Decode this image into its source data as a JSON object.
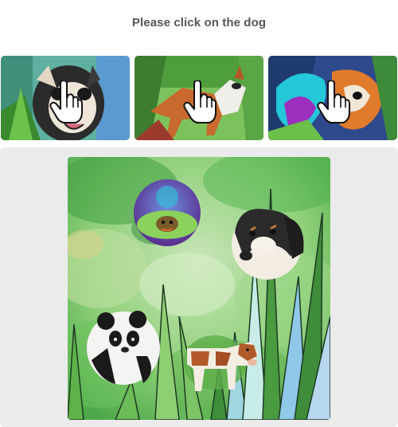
{
  "challenge": {
    "prompt": "Please click on the dog"
  },
  "examples": [
    {
      "subject": "dog",
      "icon": "pointer-hand-icon"
    },
    {
      "subject": "dog",
      "icon": "pointer-hand-icon"
    },
    {
      "subject": "dog",
      "icon": "pointer-hand-icon"
    }
  ],
  "puzzle": {
    "animals": [
      "turtle",
      "dog",
      "panda",
      "cow"
    ]
  },
  "colors": {
    "panel_bg": "#ebebeb",
    "title_text": "#555555",
    "watercolor_green": "#4faa4a"
  }
}
